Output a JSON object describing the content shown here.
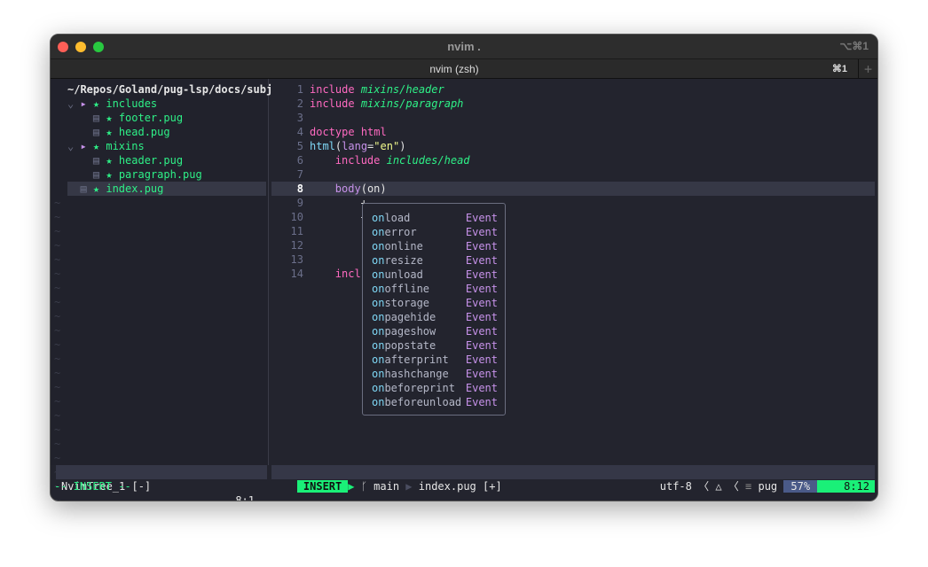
{
  "window": {
    "title": "nvim .",
    "shortcut": "⌥⌘1",
    "tab": "nvim (zsh)",
    "tab_shortcut": "⌘1",
    "new_tab": "+"
  },
  "tree": {
    "path": "~/Repos/Goland/pug-lsp/docs/subj",
    "items": [
      {
        "label": "includes",
        "type": "folder",
        "depth": 0
      },
      {
        "label": "footer.pug",
        "type": "file",
        "depth": 1
      },
      {
        "label": "head.pug",
        "type": "file",
        "depth": 1
      },
      {
        "label": "mixins",
        "type": "folder",
        "depth": 0
      },
      {
        "label": "header.pug",
        "type": "file",
        "depth": 1
      },
      {
        "label": "paragraph.pug",
        "type": "file",
        "depth": 1
      },
      {
        "label": "index.pug",
        "type": "file",
        "depth": 0,
        "selected": true
      }
    ],
    "status_name": "NvimTree_1 [-]",
    "status_pos": "8:1"
  },
  "editor": {
    "lines": [
      "1",
      "2",
      "3",
      "4",
      "5",
      "6",
      "7",
      "8",
      "9",
      "10",
      "11",
      "12",
      "13",
      "14"
    ],
    "current_line": "8",
    "code": {
      "l1a": "include",
      "l1b": "mixins/header",
      "l2a": "include",
      "l2b": "mixins/paragraph",
      "l4a": "doctype",
      "l4b": "html",
      "l5a": "html",
      "l5b": "(",
      "l5c": "lang",
      "l5d": "=",
      "l5e": "\"en\"",
      "l5f": ")",
      "l6a": "include",
      "l6b": "includes/head",
      "l8a": "body",
      "l8b": "(",
      "l8c": "on",
      "l8d": ")",
      "l9": "+",
      "l10": "+",
      "l14": "incl"
    }
  },
  "completion": {
    "prefix": "on",
    "kind": "Event",
    "items": [
      "load",
      "error",
      "online",
      "resize",
      "unload",
      "offline",
      "storage",
      "pagehide",
      "pageshow",
      "popstate",
      "afterprint",
      "hashchange",
      "beforeprint",
      "beforeunload"
    ]
  },
  "statusline": {
    "mode": "INSERT",
    "branch": "main",
    "file": "index.pug [+]",
    "encoding": "utf-8",
    "filetype": "pug",
    "percent": "57%",
    "position": "8:12"
  },
  "cmdline": "-- INSERT --",
  "colors": {
    "accent": "#1af078",
    "keyword": "#ff6ac1",
    "string_green": "#2ef087",
    "match": "#7fd7f5",
    "kind": "#c792ea"
  }
}
